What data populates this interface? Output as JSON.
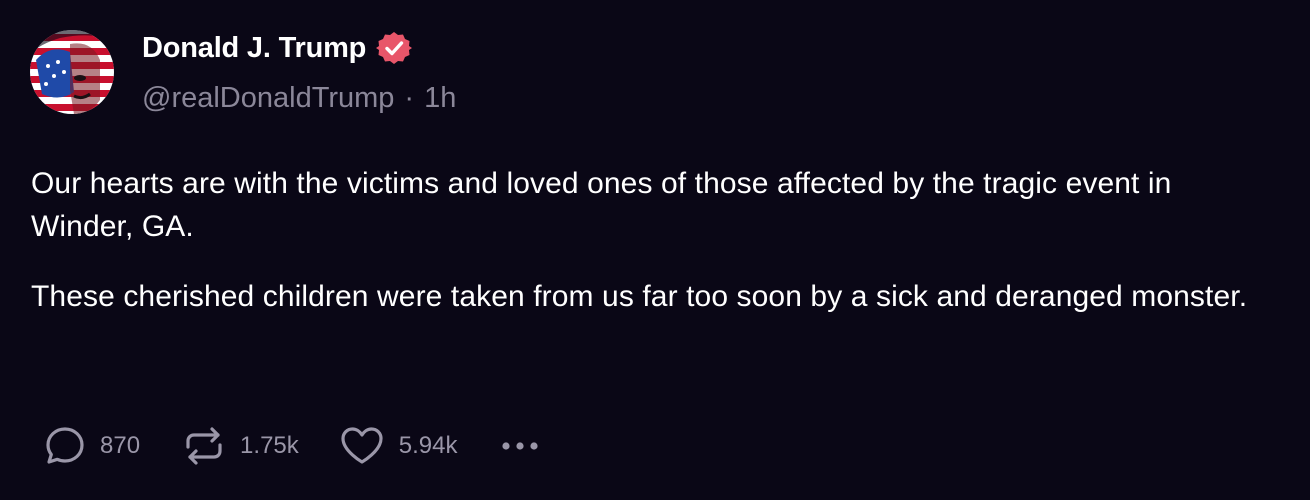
{
  "post": {
    "author": {
      "display_name": "Donald J. Trump",
      "handle": "@realDonaldTrump",
      "separator": "·",
      "time": "1h",
      "verified": true
    },
    "paragraphs": [
      "Our hearts are with the victims and loved ones of those affected by the tragic event in Winder, GA.",
      "These cherished children were taken from us far too soon by a sick and deranged monster."
    ],
    "actions": {
      "replies": "870",
      "reposts": "1.75k",
      "likes": "5.94k"
    }
  },
  "colors": {
    "background": "#0a0716",
    "text": "#ffffff",
    "muted": "#8b8799",
    "verified_badge": "#e8566a"
  }
}
